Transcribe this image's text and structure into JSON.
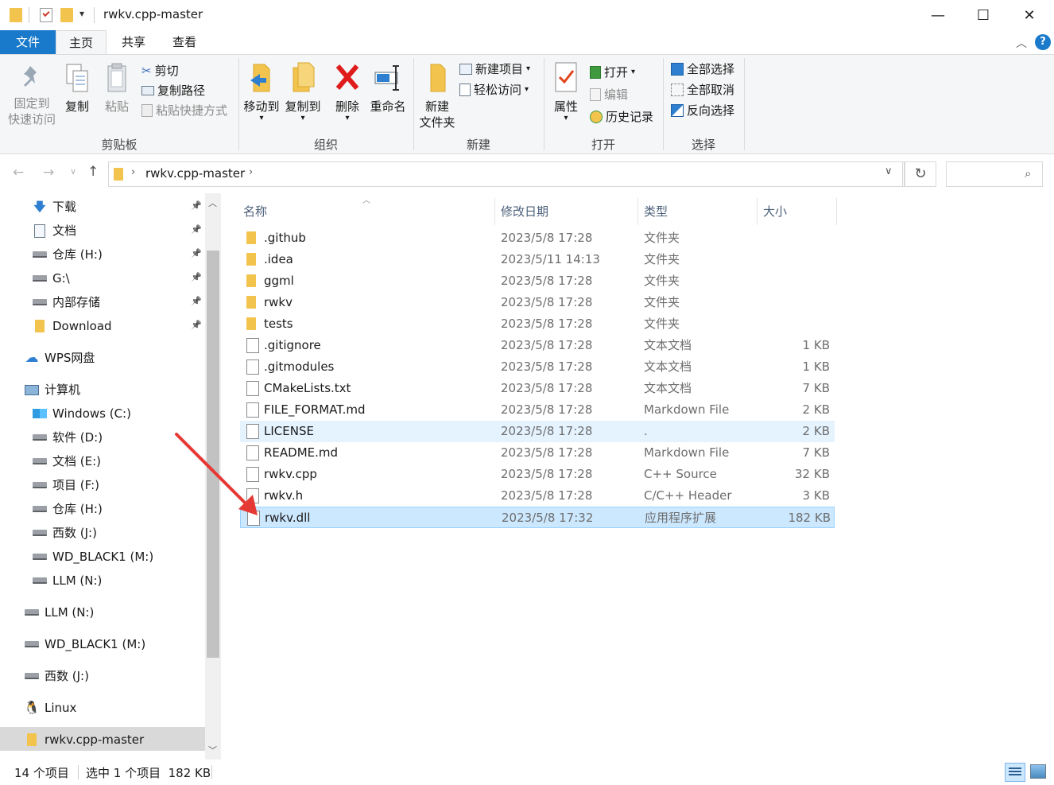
{
  "window": {
    "title": "rwkv.cpp-master",
    "min_glyph": "—",
    "max_glyph": "☐",
    "close_glyph": "✕",
    "help_glyph": "?"
  },
  "ribbon_tabs": [
    {
      "label": "文件"
    },
    {
      "label": "主页"
    },
    {
      "label": "共享"
    },
    {
      "label": "查看"
    }
  ],
  "ribbon": {
    "clipboard": {
      "label": "剪贴板",
      "pin_line1": "固定到",
      "pin_line2": "快速访问",
      "copy": "复制",
      "paste": "粘贴",
      "cut": "剪切",
      "copy_path": "复制路径",
      "paste_shortcut": "粘贴快捷方式"
    },
    "organize": {
      "label": "组织",
      "move_to": "移动到",
      "copy_to": "复制到",
      "delete": "删除",
      "rename": "重命名"
    },
    "new": {
      "label": "新建",
      "new_folder_line1": "新建",
      "new_folder_line2": "文件夹",
      "new_item": "新建项目",
      "easy_access": "轻松访问"
    },
    "open": {
      "label": "打开",
      "properties": "属性",
      "open": "打开",
      "edit": "编辑",
      "history": "历史记录"
    },
    "select": {
      "label": "选择",
      "select_all": "全部选择",
      "select_none": "全部取消",
      "invert": "反向选择"
    }
  },
  "address": {
    "crumb": "rwkv.cpp-master",
    "search_placeholder": ""
  },
  "nav": {
    "items": [
      {
        "label": "下载",
        "icon": "download-arrow-icon",
        "pinned": true
      },
      {
        "label": "文档",
        "icon": "document-icon",
        "pinned": true
      },
      {
        "label": "仓库 (H:)",
        "icon": "drive-icon",
        "pinned": true
      },
      {
        "label": "G:\\",
        "icon": "drive-unknown-icon",
        "pinned": true
      },
      {
        "label": "内部存储",
        "icon": "drive-icon",
        "pinned": true
      },
      {
        "label": "Download",
        "icon": "folder-icon",
        "pinned": true
      },
      {
        "label": "WPS网盘",
        "icon": "cloud-icon",
        "pinned": false
      },
      {
        "label": "计算机",
        "icon": "computer-icon",
        "pinned": false
      },
      {
        "label": "Windows (C:)",
        "icon": "windows-drive-icon",
        "pinned": false
      },
      {
        "label": "软件 (D:)",
        "icon": "drive-icon",
        "pinned": false
      },
      {
        "label": "文档 (E:)",
        "icon": "drive-icon",
        "pinned": false
      },
      {
        "label": "项目 (F:)",
        "icon": "drive-icon",
        "pinned": false
      },
      {
        "label": "仓库 (H:)",
        "icon": "drive-icon",
        "pinned": false
      },
      {
        "label": "西数 (J:)",
        "icon": "drive-icon",
        "pinned": false
      },
      {
        "label": "WD_BLACK1 (M:)",
        "icon": "drive-icon",
        "pinned": false
      },
      {
        "label": "LLM (N:)",
        "icon": "drive-icon",
        "pinned": false
      },
      {
        "label": "LLM (N:)",
        "icon": "drive-icon",
        "pinned": false
      },
      {
        "label": "WD_BLACK1 (M:)",
        "icon": "drive-icon",
        "pinned": false
      },
      {
        "label": "西数 (J:)",
        "icon": "drive-icon",
        "pinned": false
      },
      {
        "label": "Linux",
        "icon": "linux-icon",
        "pinned": false
      },
      {
        "label": "rwkv.cpp-master",
        "icon": "folder-icon",
        "pinned": false,
        "selected": true
      }
    ]
  },
  "columns": {
    "name": "名称",
    "date": "修改日期",
    "type": "类型",
    "size": "大小"
  },
  "files": [
    {
      "name": ".github",
      "date": "2023/5/8 17:28",
      "type": "文件夹",
      "size": "",
      "kind": "folder"
    },
    {
      "name": ".idea",
      "date": "2023/5/11 14:13",
      "type": "文件夹",
      "size": "",
      "kind": "folder"
    },
    {
      "name": "ggml",
      "date": "2023/5/8 17:28",
      "type": "文件夹",
      "size": "",
      "kind": "folder"
    },
    {
      "name": "rwkv",
      "date": "2023/5/8 17:28",
      "type": "文件夹",
      "size": "",
      "kind": "folder"
    },
    {
      "name": "tests",
      "date": "2023/5/8 17:28",
      "type": "文件夹",
      "size": "",
      "kind": "folder"
    },
    {
      "name": ".gitignore",
      "date": "2023/5/8 17:28",
      "type": "文本文档",
      "size": "1 KB",
      "kind": "text"
    },
    {
      "name": ".gitmodules",
      "date": "2023/5/8 17:28",
      "type": "文本文档",
      "size": "1 KB",
      "kind": "text"
    },
    {
      "name": "CMakeLists.txt",
      "date": "2023/5/8 17:28",
      "type": "文本文档",
      "size": "7 KB",
      "kind": "text"
    },
    {
      "name": "FILE_FORMAT.md",
      "date": "2023/5/8 17:28",
      "type": "Markdown File",
      "size": "2 KB",
      "kind": "markdown"
    },
    {
      "name": "LICENSE",
      "date": "2023/5/8 17:28",
      "type": ".",
      "size": "2 KB",
      "kind": "blank",
      "state": "hover"
    },
    {
      "name": "README.md",
      "date": "2023/5/8 17:28",
      "type": "Markdown File",
      "size": "7 KB",
      "kind": "markdown"
    },
    {
      "name": "rwkv.cpp",
      "date": "2023/5/8 17:28",
      "type": "C++ Source",
      "size": "32 KB",
      "kind": "text"
    },
    {
      "name": "rwkv.h",
      "date": "2023/5/8 17:28",
      "type": "C/C++ Header",
      "size": "3 KB",
      "kind": "header"
    },
    {
      "name": "rwkv.dll",
      "date": "2023/5/8 17:32",
      "type": "应用程序扩展",
      "size": "182 KB",
      "kind": "dll",
      "state": "selected"
    }
  ],
  "status": {
    "count": "14 个项目",
    "selection": "选中 1 个项目  182 KB"
  },
  "colors": {
    "accent": "#1979ca",
    "selection": "#cce8ff",
    "hover": "#e5f3ff",
    "annotation_arrow": "#e53935"
  }
}
